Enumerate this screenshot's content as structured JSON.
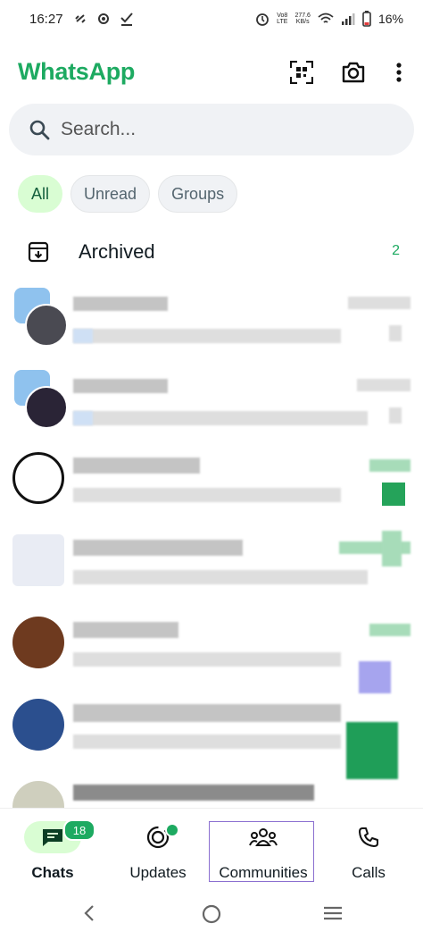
{
  "status_bar": {
    "time": "16:27",
    "net_top": "Vo8",
    "net_bottom": "LTE",
    "speed_top": "277.6",
    "speed_bottom": "KB/s",
    "battery": "16%"
  },
  "app": {
    "title": "WhatsApp",
    "brand_color": "#1daa61"
  },
  "search": {
    "placeholder": "Search..."
  },
  "filters": [
    {
      "label": "All",
      "active": true
    },
    {
      "label": "Unread",
      "active": false
    },
    {
      "label": "Groups",
      "active": false
    }
  ],
  "archived": {
    "label": "Archived",
    "count": "2"
  },
  "bottom_nav": {
    "chats": {
      "label": "Chats",
      "badge": "18"
    },
    "updates": {
      "label": "Updates"
    },
    "communities": {
      "label": "Communities"
    },
    "calls": {
      "label": "Calls"
    }
  },
  "icons": {
    "search": "search-icon",
    "camera": "camera-icon",
    "qr": "qr-scan-icon",
    "menu": "overflow-menu-icon",
    "archive": "archive-icon"
  }
}
